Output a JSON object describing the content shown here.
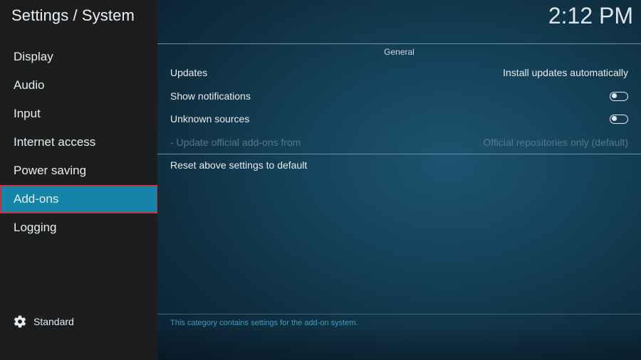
{
  "header": {
    "title": "Settings / System",
    "clock": "2:12 PM"
  },
  "sidebar": {
    "items": [
      {
        "label": "Display"
      },
      {
        "label": "Audio"
      },
      {
        "label": "Input"
      },
      {
        "label": "Internet access"
      },
      {
        "label": "Power saving"
      },
      {
        "label": "Add-ons",
        "active": true
      },
      {
        "label": "Logging"
      }
    ],
    "level": {
      "icon": "gear-icon",
      "label": "Standard"
    }
  },
  "main": {
    "section_title": "General",
    "settings": [
      {
        "label": "Updates",
        "value": "Install updates automatically"
      },
      {
        "label": "Show notifications",
        "toggle": false
      },
      {
        "label": "Unknown sources",
        "toggle": false
      },
      {
        "label": "- Update official add-ons from",
        "value": "Official repositories only (default)",
        "disabled": true
      }
    ],
    "reset_label": "Reset above settings to default",
    "description": "This category contains settings for the add-on system."
  },
  "colors": {
    "accent": "#1484a8",
    "focus_border": "#c5323d",
    "sidebar_bg": "#1b1d1f",
    "description_text": "#3c9ec0"
  }
}
